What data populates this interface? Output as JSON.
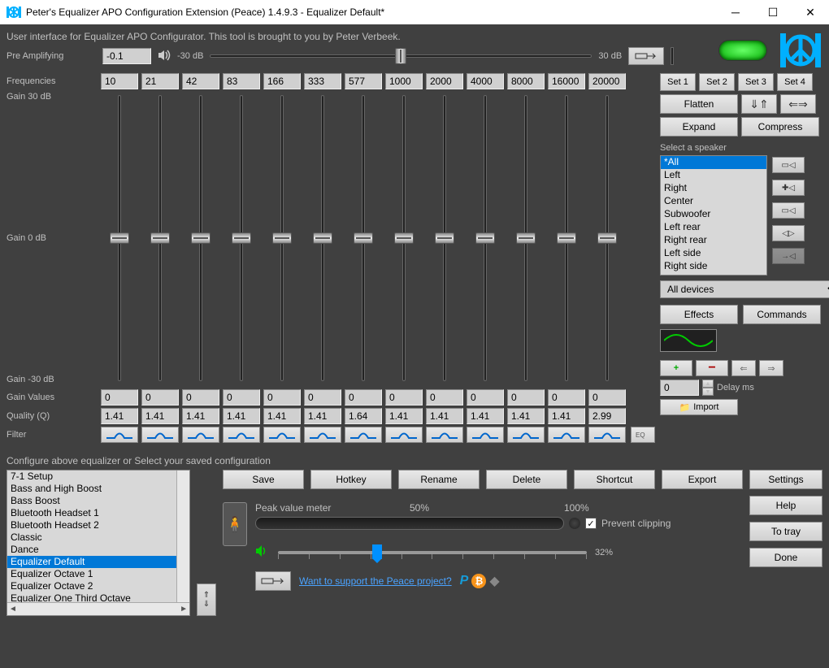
{
  "window": {
    "title": "Peter's Equalizer APO Configuration Extension (Peace) 1.4.9.3 - Equalizer Default*"
  },
  "subtitle": "User interface for Equalizer APO Configurator. This tool is brought to you by Peter Verbeek.",
  "preamp": {
    "label": "Pre Amplifying",
    "value": "-0.1",
    "db_min": "-30 dB",
    "db_max": "30 dB"
  },
  "labels": {
    "frequencies": "Frequencies",
    "gain30": "Gain 30 dB",
    "gain0": "Gain 0 dB",
    "gainm30": "Gain -30 dB",
    "gain_values": "Gain Values",
    "quality": "Quality (Q)",
    "filter": "Filter",
    "select_speaker": "Select a speaker",
    "config_instruction": "Configure above equalizer or Select your saved configuration",
    "peak_meter": "Peak value meter",
    "pct50": "50%",
    "pct100": "100%",
    "prevent_clipping": "Prevent clipping",
    "volume_pct": "32%",
    "support": "Want to support the Peace project?",
    "delay_ms": "Delay ms"
  },
  "bands": [
    {
      "freq": "10",
      "gain": "0",
      "q": "1.41"
    },
    {
      "freq": "21",
      "gain": "0",
      "q": "1.41"
    },
    {
      "freq": "42",
      "gain": "0",
      "q": "1.41"
    },
    {
      "freq": "83",
      "gain": "0",
      "q": "1.41"
    },
    {
      "freq": "166",
      "gain": "0",
      "q": "1.41"
    },
    {
      "freq": "333",
      "gain": "0",
      "q": "1.41"
    },
    {
      "freq": "577",
      "gain": "0",
      "q": "1.64"
    },
    {
      "freq": "1000",
      "gain": "0",
      "q": "1.41"
    },
    {
      "freq": "2000",
      "gain": "0",
      "q": "1.41"
    },
    {
      "freq": "4000",
      "gain": "0",
      "q": "1.41"
    },
    {
      "freq": "8000",
      "gain": "0",
      "q": "1.41"
    },
    {
      "freq": "16000",
      "gain": "0",
      "q": "1.41"
    },
    {
      "freq": "20000",
      "gain": "0",
      "q": "2.99"
    }
  ],
  "set_buttons": [
    "Set 1",
    "Set 2",
    "Set 3",
    "Set 4"
  ],
  "side_buttons": {
    "flatten": "Flatten",
    "expand": "Expand",
    "compress": "Compress",
    "effects": "Effects",
    "commands": "Commands",
    "import": "Import"
  },
  "speakers": [
    "*All",
    "Left",
    "Right",
    "Center",
    "Subwoofer",
    "Left rear",
    "Right rear",
    "Left side",
    "Right side"
  ],
  "speaker_selected": 0,
  "device": "All devices",
  "delay_value": "0",
  "presets": [
    "7-1 Setup",
    "Bass and High Boost",
    "Bass Boost",
    "Bluetooth Headset 1",
    "Bluetooth Headset 2",
    "Classic",
    "Dance",
    "Equalizer Default",
    "Equalizer Octave 1",
    "Equalizer Octave 2",
    "Equalizer One Third Octave"
  ],
  "preset_selected": 7,
  "action_buttons": [
    "Save",
    "Hotkey",
    "Rename",
    "Delete",
    "Shortcut",
    "Export"
  ],
  "right_buttons": [
    "Settings",
    "Help",
    "To tray",
    "Done"
  ],
  "prevent_clipping_checked": true,
  "colors": {
    "accent": "#0078d7",
    "link": "#4aa3ff",
    "power": "#00c000"
  }
}
